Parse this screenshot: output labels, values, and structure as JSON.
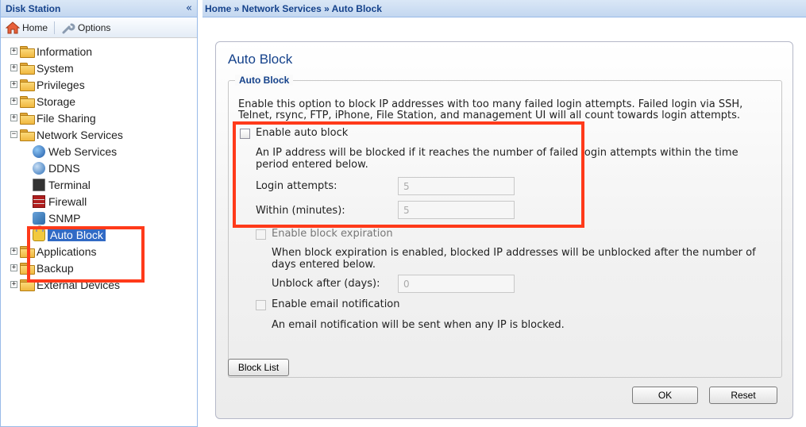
{
  "sidebar": {
    "title": "Disk Station",
    "collapse_glyph": "«",
    "toolbar": {
      "home_label": "Home",
      "options_label": "Options"
    },
    "tree": {
      "information": "Information",
      "system": "System",
      "privileges": "Privileges",
      "storage": "Storage",
      "file_sharing": "File Sharing",
      "network_services": "Network Services",
      "web_services": "Web Services",
      "ddns": "DDNS",
      "terminal": "Terminal",
      "firewall": "Firewall",
      "snmp": "SNMP",
      "auto_block": "Auto Block",
      "applications": "Applications",
      "backup": "Backup",
      "external_devices": "External Devices"
    }
  },
  "breadcrumb": "Home » Network Services » Auto Block",
  "panel": {
    "title": "Auto Block",
    "fieldset_legend": "Auto Block",
    "description_line1": "Enable this option to block IP addresses with too many failed login attempts. Failed login via SSH,",
    "description_line2": "Telnet, rsync, FTP, iPhone, File Station, and management UI will all count towards login attempts.",
    "enable_auto_block_label": "Enable auto block",
    "auto_block_help_line1": "An IP address will be blocked if it reaches the number of failed login attempts within the time",
    "auto_block_help_line2": "period entered below.",
    "login_attempts_label": "Login attempts:",
    "login_attempts_value": "5",
    "within_minutes_label": "Within (minutes):",
    "within_minutes_value": "5",
    "enable_block_expiration_label": "Enable block expiration",
    "expiration_help_line1": "When block expiration is enabled, blocked IP addresses will be unblocked after the number of",
    "expiration_help_line2": "days entered below.",
    "unblock_after_label": "Unblock after (days):",
    "unblock_after_value": "0",
    "enable_email_label": "Enable email notification",
    "email_help": "An email notification will be sent when any IP is blocked.",
    "block_list_button": "Block List",
    "ok_button": "OK",
    "reset_button": "Reset"
  },
  "colors": {
    "accent": "#15428b",
    "annotation": "#ff3a1a",
    "selection": "#316ac5"
  }
}
